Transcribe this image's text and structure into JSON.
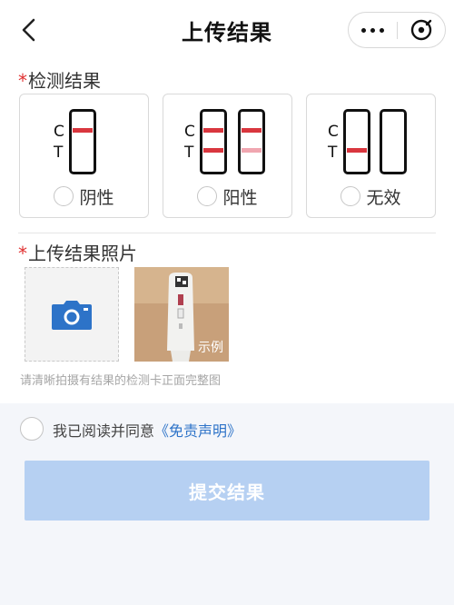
{
  "nav": {
    "title": "上传结果",
    "back_icon": "chevron-left-icon",
    "more_icon": "more-dots-icon",
    "close_icon": "target-close-icon"
  },
  "result_section": {
    "required_mark": "*",
    "label": "检测结果",
    "options": [
      {
        "label": "阴性",
        "strip_letters": [
          "C",
          "T"
        ]
      },
      {
        "label": "阳性",
        "strip_letters": [
          "C",
          "T"
        ]
      },
      {
        "label": "无效",
        "strip_letters": [
          "C",
          "T"
        ]
      }
    ]
  },
  "photo_section": {
    "required_mark": "*",
    "label": "上传结果照片",
    "upload_icon": "camera-icon",
    "example_tag": "示例",
    "hint": "请清晰拍摄有结果的检测卡正面完整图"
  },
  "agreement": {
    "text": "我已阅读并同意",
    "link": "《免责声明》"
  },
  "submit": {
    "label": "提交结果"
  },
  "colors": {
    "required": "#e03030",
    "strip_line": "#d9363e",
    "strip_line_faint": "#f0a6b0",
    "link": "#2d73c8",
    "submit_bg": "#b6d0f2",
    "camera": "#2d73c8"
  }
}
